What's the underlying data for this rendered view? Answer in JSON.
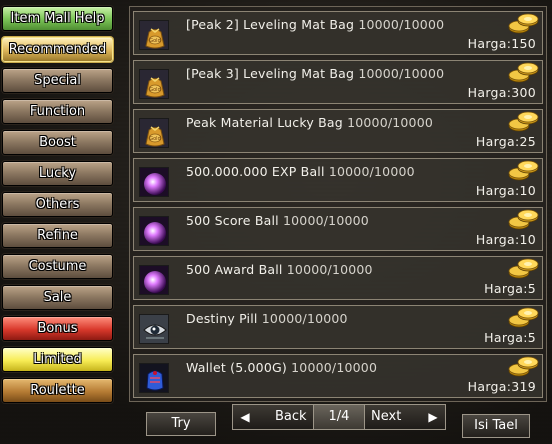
{
  "categories": [
    {
      "label": "Item Mall Help",
      "style": "green"
    },
    {
      "label": "Recommended",
      "style": "gold"
    },
    {
      "label": "Special",
      "style": "normal"
    },
    {
      "label": "Function",
      "style": "normal"
    },
    {
      "label": "Boost",
      "style": "normal"
    },
    {
      "label": "Lucky",
      "style": "normal"
    },
    {
      "label": "Others",
      "style": "normal"
    },
    {
      "label": "Refine",
      "style": "normal"
    },
    {
      "label": "Costume",
      "style": "normal"
    },
    {
      "label": "Sale",
      "style": "normal"
    },
    {
      "label": "Bonus",
      "style": "red"
    },
    {
      "label": "Limited",
      "style": "yellow"
    },
    {
      "label": "Roulette",
      "style": "roulette"
    }
  ],
  "items": [
    {
      "name": "[Peak 2] Leveling Mat Bag",
      "stock": "10000/10000",
      "price": "Harga:150",
      "icon": "gold-bag-icon"
    },
    {
      "name": "[Peak 3] Leveling Mat Bag",
      "stock": "10000/10000",
      "price": "Harga:300",
      "icon": "gold-bag-icon"
    },
    {
      "name": "Peak Material Lucky Bag",
      "stock": "10000/10000",
      "price": "Harga:25",
      "icon": "gold-bag-icon"
    },
    {
      "name": "500.000.000 EXP Ball",
      "stock": "10000/10000",
      "price": "Harga:10",
      "icon": "purple-orb-icon"
    },
    {
      "name": "500 Score Ball",
      "stock": "10000/10000",
      "price": "Harga:10",
      "icon": "purple-orb-icon"
    },
    {
      "name": "500 Award Ball",
      "stock": "10000/10000",
      "price": "Harga:5",
      "icon": "purple-orb-icon"
    },
    {
      "name": "Destiny Pill",
      "stock": "10000/10000",
      "price": "Harga:5",
      "icon": "eye-pill-icon"
    },
    {
      "name": "Wallet (5.000G)",
      "stock": "10000/10000",
      "price": "Harga:319",
      "icon": "wallet-icon"
    }
  ],
  "bottom": {
    "try_label": "Try",
    "back_label": "Back",
    "page": "1/4",
    "next_label": "Next",
    "topup_label": "Isi Tael",
    "prev_arrow": "◀",
    "next_arrow": "▶"
  },
  "colors": {
    "panel_border": "#8c8474",
    "text": "#f2f0ea"
  }
}
